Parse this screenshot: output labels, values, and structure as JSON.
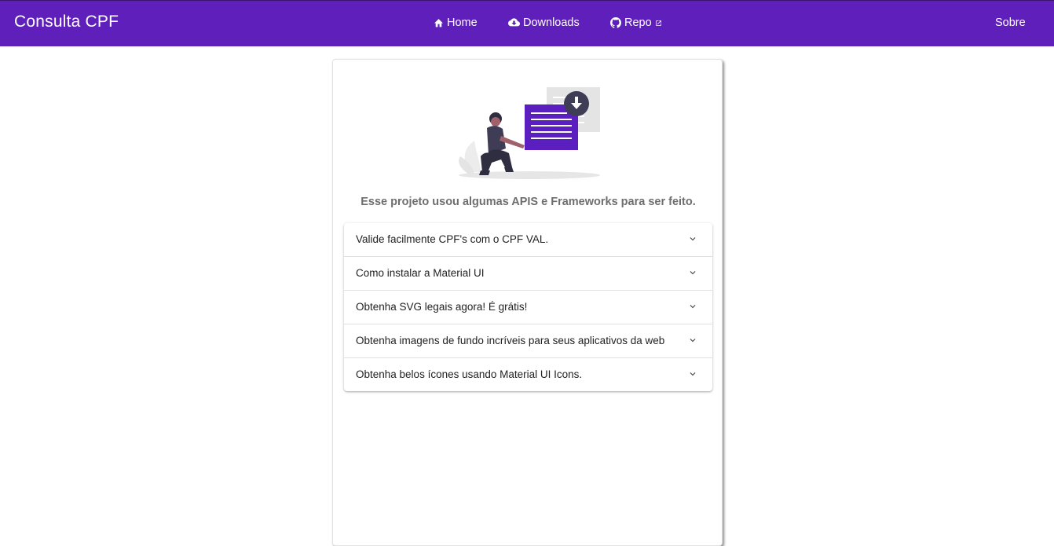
{
  "header": {
    "brand": "Consulta CPF",
    "nav": [
      {
        "label": "Home",
        "icon": "home-icon"
      },
      {
        "label": "Downloads",
        "icon": "cloud-download-icon"
      },
      {
        "label": "Repo",
        "icon": "github-icon",
        "trailing_icon": "external-link-icon"
      }
    ],
    "about": "Sobre"
  },
  "card": {
    "illustration": "person-with-download-document-illustration",
    "subtitle": "Esse projeto usou algumas APIS e Frameworks para ser feito.",
    "accordion": [
      {
        "label": "Valide facilmente CPF's com o CPF VAL."
      },
      {
        "label": "Como instalar a Material UI"
      },
      {
        "label": "Obtenha SVG legais agora! É grátis!"
      },
      {
        "label": "Obtenha imagens de fundo incríveis para seus aplicativos da web"
      },
      {
        "label": "Obtenha belos ícones usando Material UI Icons."
      }
    ]
  },
  "colors": {
    "navbar": "#5f1fbb",
    "accent_purple": "#5b1ebf",
    "text": "#222222",
    "subtitle": "#6e6e6e"
  }
}
